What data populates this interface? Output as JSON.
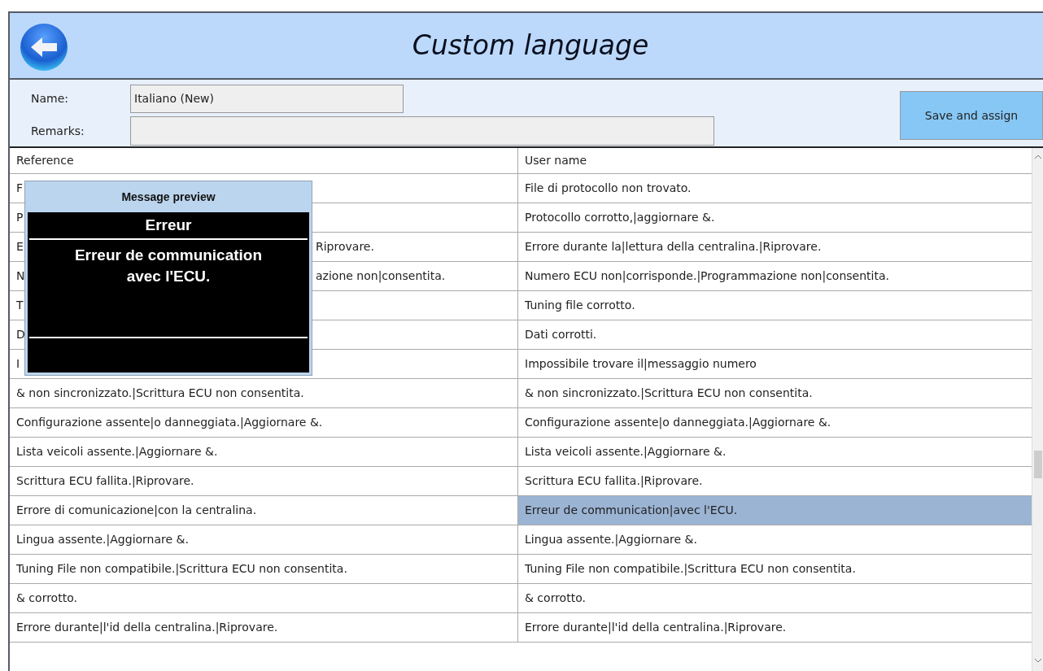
{
  "window": {
    "title": "Custom language"
  },
  "form": {
    "name_label": "Name:",
    "name_value": "Italiano (New)",
    "remarks_label": "Remarks:",
    "save_button": "Save and assign"
  },
  "table": {
    "columns": [
      "Reference",
      "User name"
    ],
    "rows": [
      {
        "reference": [
          "F"
        ],
        "user_name": "File di protocollo non trovato.",
        "selected": false
      },
      {
        "reference": [
          "P"
        ],
        "user_name": "Protocollo corrotto,|aggiornare &.",
        "selected": false
      },
      {
        "reference": [
          "E",
          "Riprovare."
        ],
        "user_name": "Errore durante la|lettura della centralina.|Riprovare.",
        "selected": false
      },
      {
        "reference": [
          "N",
          "azione non|consentita."
        ],
        "user_name": "Numero ECU non|corrisponde.|Programmazione non|consentita.",
        "selected": false
      },
      {
        "reference": [
          "T"
        ],
        "user_name": "Tuning file corrotto.",
        "selected": false
      },
      {
        "reference": [
          "D"
        ],
        "user_name": "Dati corrotti.",
        "selected": false
      },
      {
        "reference": [
          "I"
        ],
        "user_name": "Impossibile trovare il|messaggio numero",
        "selected": false
      },
      {
        "reference": [
          "& non sincronizzato.|Scrittura ECU non consentita."
        ],
        "user_name": "& non sincronizzato.|Scrittura ECU non consentita.",
        "selected": false
      },
      {
        "reference": [
          "Configurazione assente|o danneggiata.|Aggiornare &."
        ],
        "user_name": "Configurazione assente|o danneggiata.|Aggiornare &.",
        "selected": false
      },
      {
        "reference": [
          "Lista veicoli assente.|Aggiornare &."
        ],
        "user_name": "Lista veicoli assente.|Aggiornare &.",
        "selected": false
      },
      {
        "reference": [
          "Scrittura ECU fallita.|Riprovare."
        ],
        "user_name": "Scrittura ECU fallita.|Riprovare.",
        "selected": false
      },
      {
        "reference": [
          "Errore di comunicazione|con la centralina."
        ],
        "user_name": "Erreur de communication|avec l'ECU.",
        "selected": true
      },
      {
        "reference": [
          "Lingua assente.|Aggiornare &."
        ],
        "user_name": "Lingua assente.|Aggiornare &.",
        "selected": false
      },
      {
        "reference": [
          "Tuning File non compatibile.|Scrittura ECU non consentita."
        ],
        "user_name": "Tuning File non compatibile.|Scrittura ECU non consentita.",
        "selected": false
      },
      {
        "reference": [
          "& corrotto."
        ],
        "user_name": "& corrotto.",
        "selected": false
      },
      {
        "reference": [
          "Errore durante|l'id della centralina.|Riprovare."
        ],
        "user_name": "Errore durante|l'id della centralina.|Riprovare.",
        "selected": false
      }
    ]
  },
  "preview": {
    "title": "Message preview",
    "heading": "Erreur",
    "body_lines": [
      "Erreur de communication",
      "avec l'ECU."
    ]
  }
}
